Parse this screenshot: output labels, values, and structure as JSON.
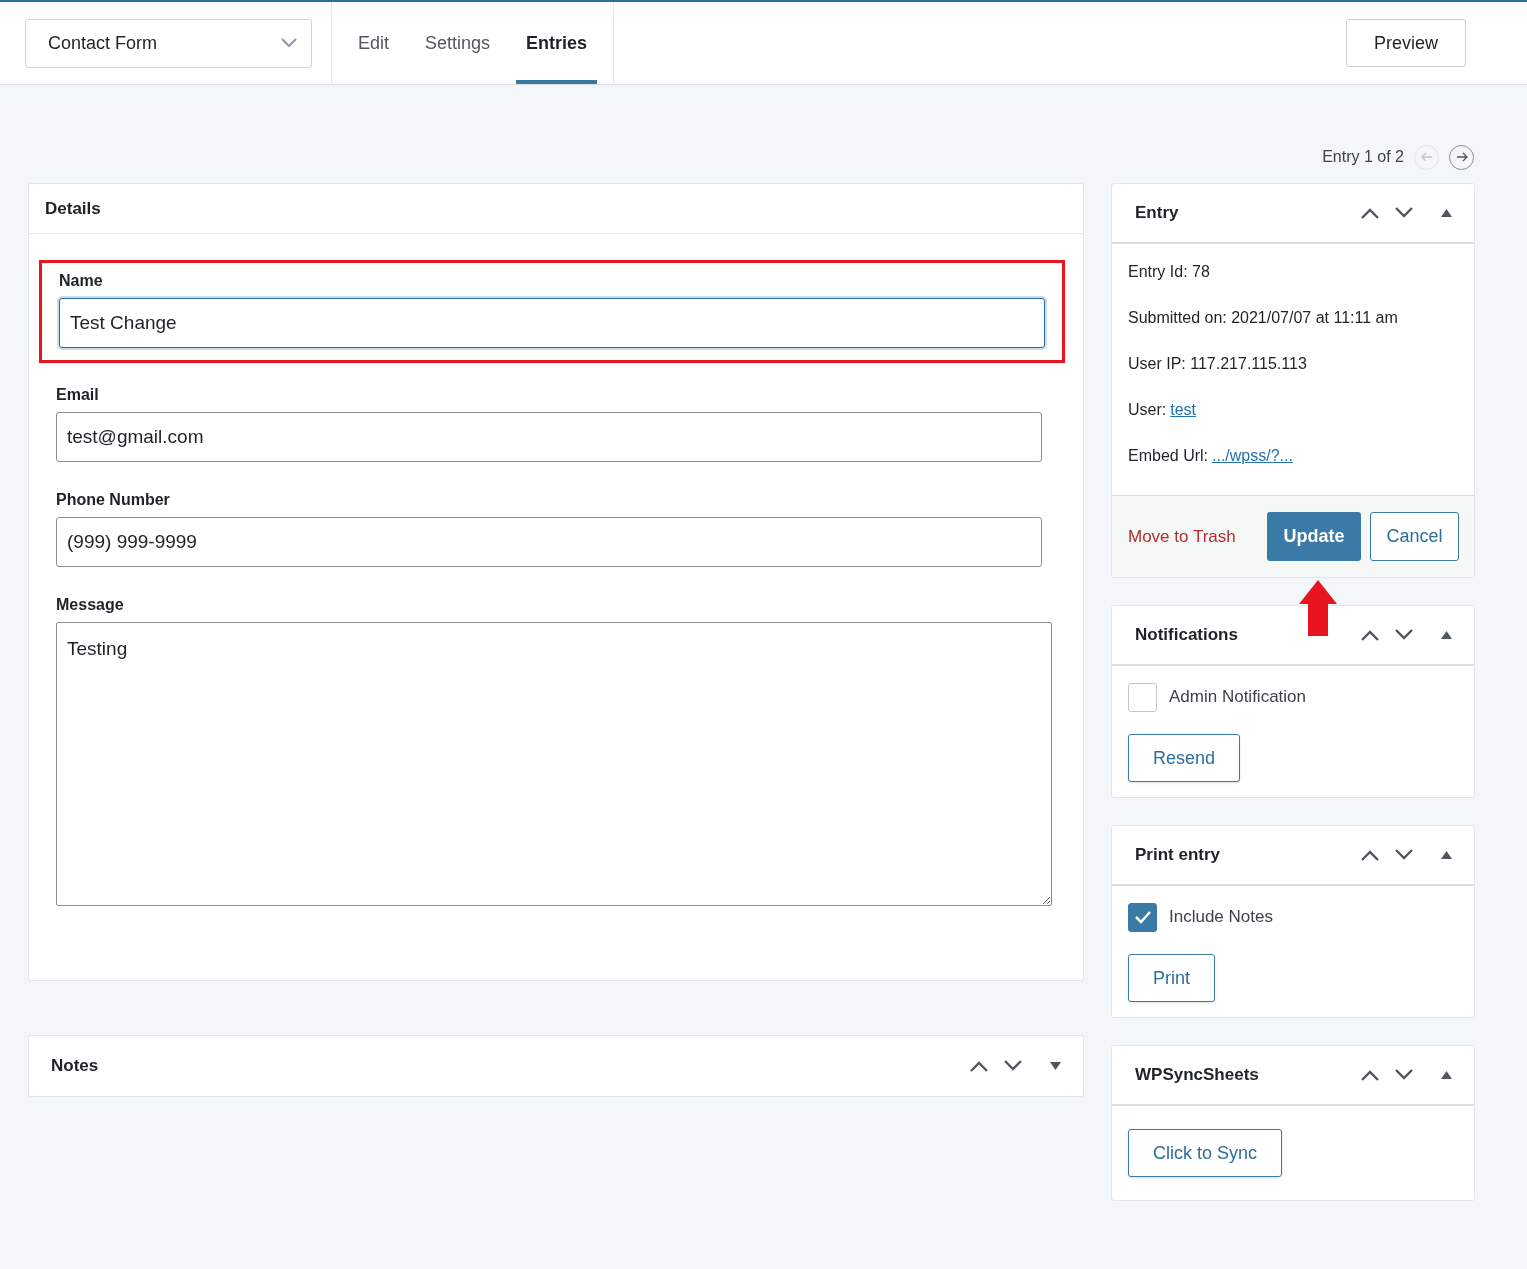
{
  "form_selector": {
    "value": "Contact Form"
  },
  "tabs": [
    {
      "label": "Edit",
      "selected": false
    },
    {
      "label": "Settings",
      "selected": false
    },
    {
      "label": "Entries",
      "selected": true
    }
  ],
  "preview_button": "Preview",
  "entry_nav": {
    "label": "Entry 1 of 2",
    "prev_disabled": true,
    "next_disabled": false
  },
  "details": {
    "title": "Details",
    "fields": [
      {
        "kind": "input",
        "label": "Name",
        "value": "Test Change",
        "focused": true,
        "highlighted": true
      },
      {
        "kind": "input",
        "label": "Email",
        "value": "test@gmail.com",
        "focused": false,
        "highlighted": false
      },
      {
        "kind": "input",
        "label": "Phone Number",
        "value": "(999) 999-9999",
        "focused": false,
        "highlighted": false
      },
      {
        "kind": "textarea",
        "label": "Message",
        "value": "Testing",
        "focused": false,
        "highlighted": false
      }
    ]
  },
  "notes": {
    "title": "Notes",
    "expanded": false
  },
  "panels": [
    {
      "kind": "entry",
      "title": "Entry",
      "expanded": true,
      "meta": [
        {
          "kind": "text",
          "label": "Entry Id:",
          "value": "78"
        },
        {
          "kind": "text",
          "label": "Submitted on:",
          "value": "2021/07/07 at 11:11 am"
        },
        {
          "kind": "text",
          "label": "User IP:",
          "value": "117.217.115.113"
        },
        {
          "kind": "link",
          "label": "User:",
          "value": "test"
        },
        {
          "kind": "link",
          "label": "Embed Url:",
          "value": ".../wpss/?..."
        }
      ],
      "trash_link": "Move to Trash",
      "update_button": "Update",
      "cancel_button": "Cancel",
      "update_pointer": true
    },
    {
      "kind": "checkbox",
      "title": "Notifications",
      "expanded": true,
      "checkbox": {
        "label": "Admin Notification",
        "checked": false
      },
      "button": "Resend"
    },
    {
      "kind": "checkbox",
      "title": "Print entry",
      "expanded": true,
      "checkbox": {
        "label": "Include Notes",
        "checked": true
      },
      "button": "Print"
    },
    {
      "kind": "button",
      "title": "WPSyncSheets",
      "expanded": true,
      "button": "Click to Sync"
    }
  ]
}
